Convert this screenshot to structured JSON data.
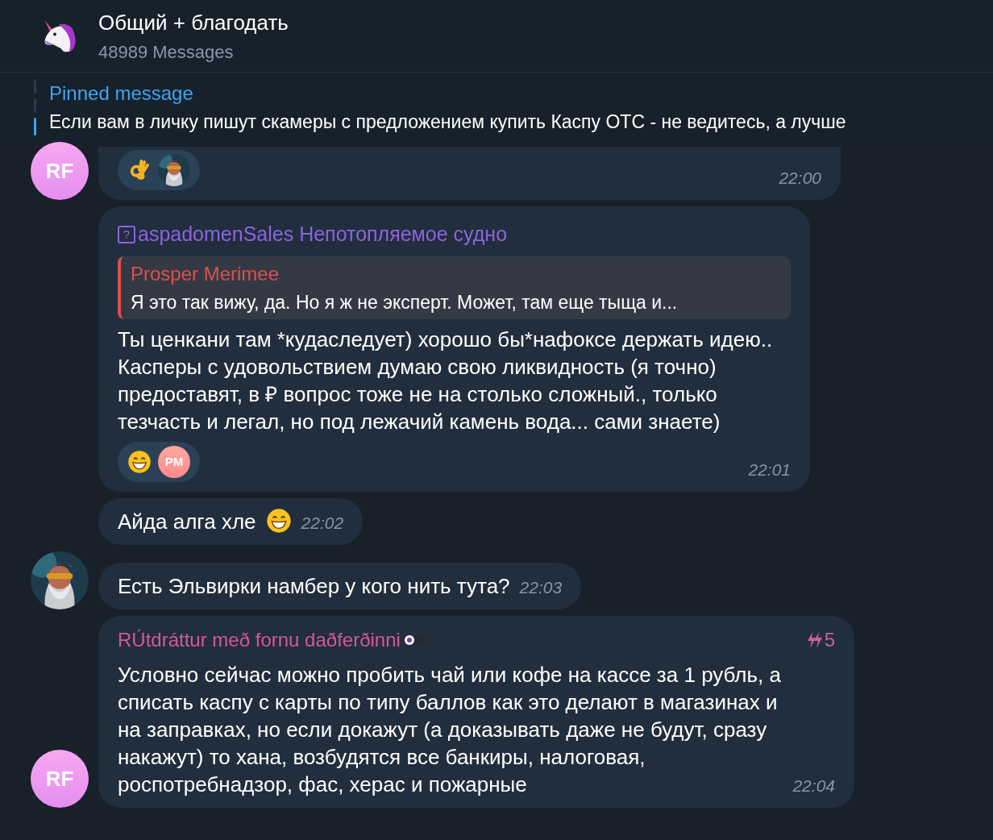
{
  "header": {
    "title": "Общий + благодать",
    "subtitle": "48989 Messages"
  },
  "pinned": {
    "label": "Pinned message",
    "text": "Если вам в личку пишут скамеры с предложением купить Каспу OTC - не ведитесь, а лучше"
  },
  "messages": [
    {
      "avatar": {
        "kind": "initials",
        "initials": "RF"
      },
      "cut_top": true,
      "reactions": [
        {
          "kind": "ok_hand"
        },
        {
          "kind": "picture"
        }
      ],
      "time": "22:00"
    },
    {
      "forward": {
        "glyph": "?",
        "name": "aspadomenSales Непотопляемое судно"
      },
      "reply": {
        "name": "Prosper Merimee",
        "text": "Я это так вижу, да. Но я ж не эксперт. Может, там еще тыща и..."
      },
      "text": "Ты ценкани там *кудаследует) хорошо бы*нафоксе держать идею..\nКасперы с удовольствием думаю свою ликвидность (я точно) предоставят, в ₽ вопрос тоже не на столько сложный., только тезчасть и легал, но под лежачий камень вода... сами знаете)",
      "reactions": [
        {
          "kind": "grin"
        },
        {
          "kind": "initials",
          "initials": "PM"
        }
      ],
      "time": "22:01"
    },
    {
      "text": "Айда алга хле",
      "trailing": {
        "kind": "grin"
      },
      "time": "22:02"
    },
    {
      "avatar": {
        "kind": "picture"
      },
      "text": "Есть Эльвирки намбер у кого нить тута?",
      "time": "22:03"
    },
    {
      "avatar": {
        "kind": "initials",
        "initials": "RF"
      },
      "sender": "RÚtdráttur með fornu daðferðinni",
      "boosts": "5",
      "text": "Условно сейчас можно пробить чай или кофе на кассе за 1 рубль, а списать каспу с карты по типу баллов как это делают в магазинах и на заправках, но если докажут (а доказывать даже не будут, сразу накажут) то хана, возбудятся все банкиры, налоговая, роспотребнадзор, фас, херас и пожарные",
      "time": "22:04"
    }
  ]
}
